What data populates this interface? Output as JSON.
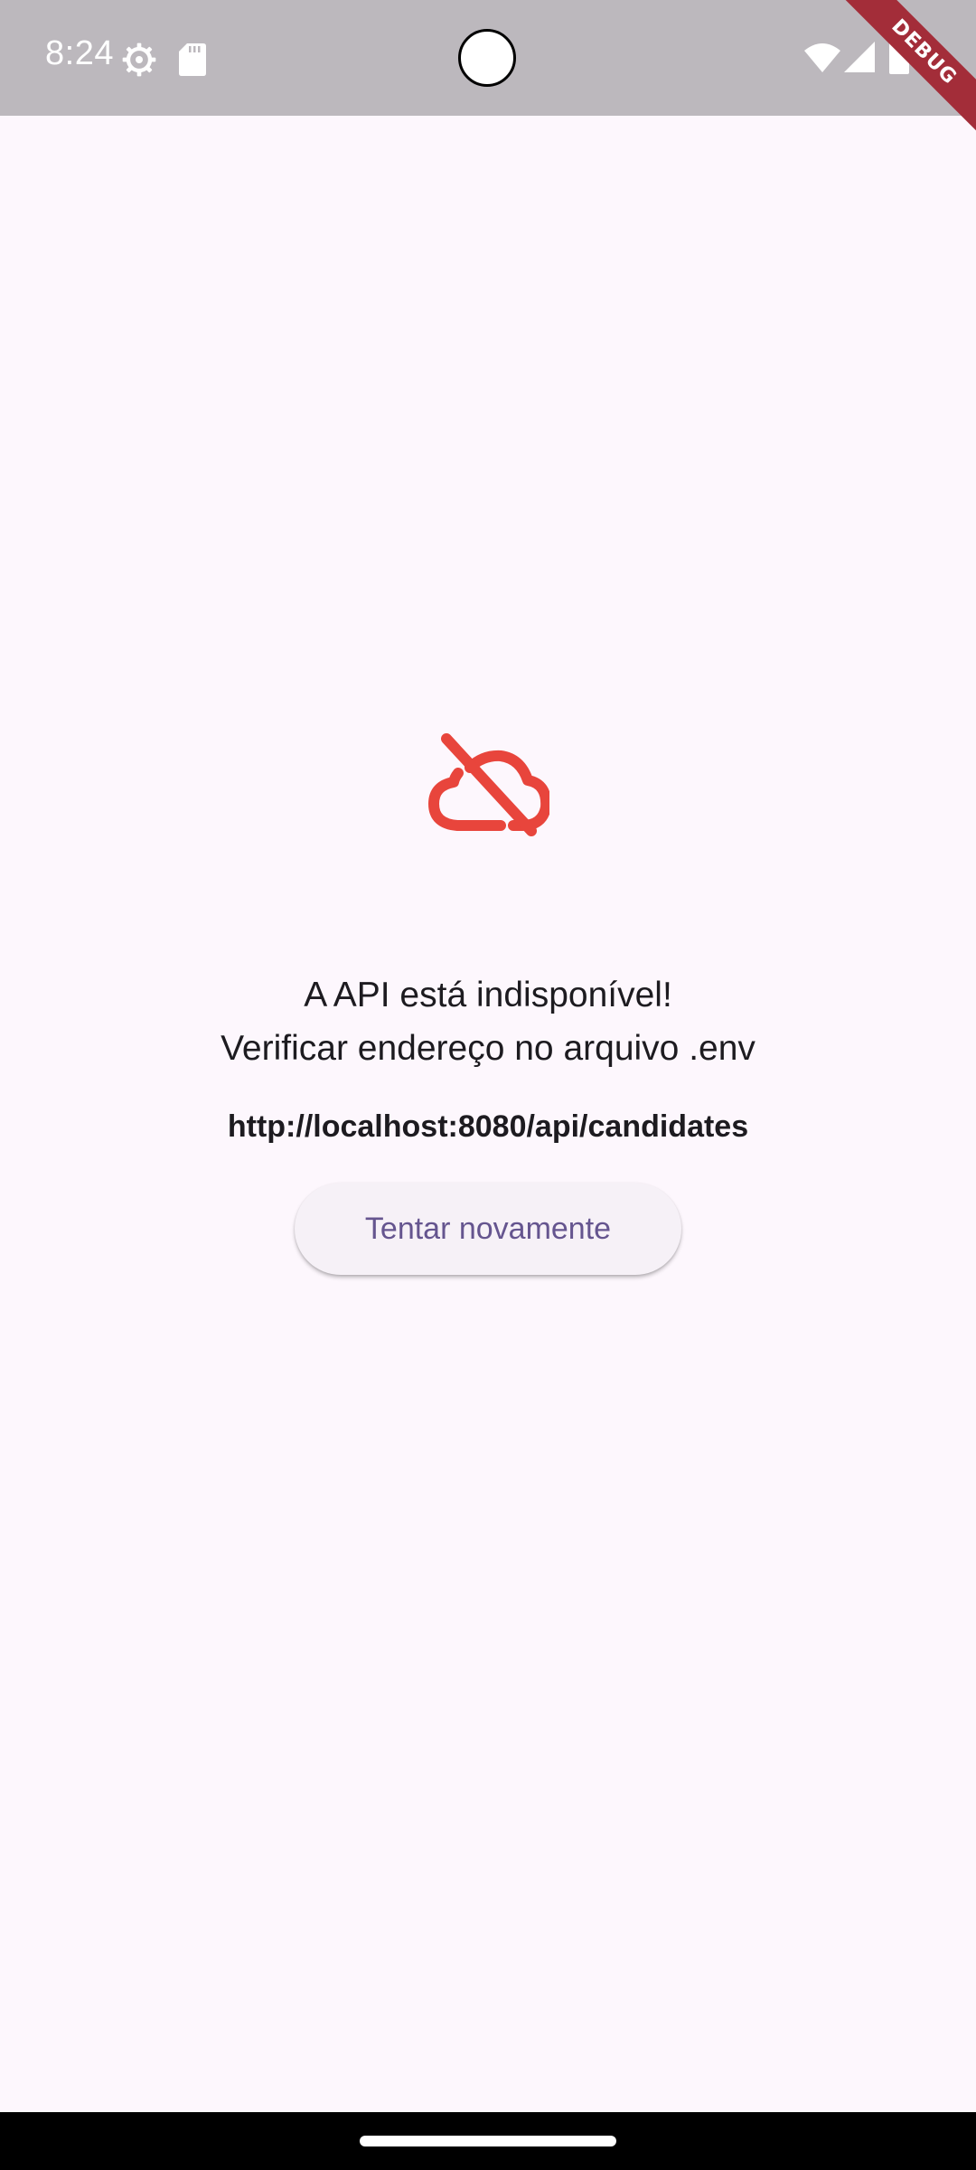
{
  "status_bar": {
    "time": "8:24",
    "icons": [
      "settings-icon",
      "sd-card-icon",
      "wifi-icon",
      "cell-signal-icon",
      "battery-icon"
    ],
    "background": "#bcb8bd"
  },
  "debug_banner": {
    "label": "DEBUG",
    "color": "#a32d39"
  },
  "error": {
    "icon": "cloud-off-icon",
    "icon_color": "#e8453c",
    "title": "A API está indisponível!",
    "subtitle": "Verificar endereço no arquivo .env",
    "url": "http://localhost:8080/api/candidates"
  },
  "retry_button": {
    "label": "Tentar novamente",
    "color": "#65558f"
  },
  "theme": {
    "background": "#fdf7fd"
  }
}
